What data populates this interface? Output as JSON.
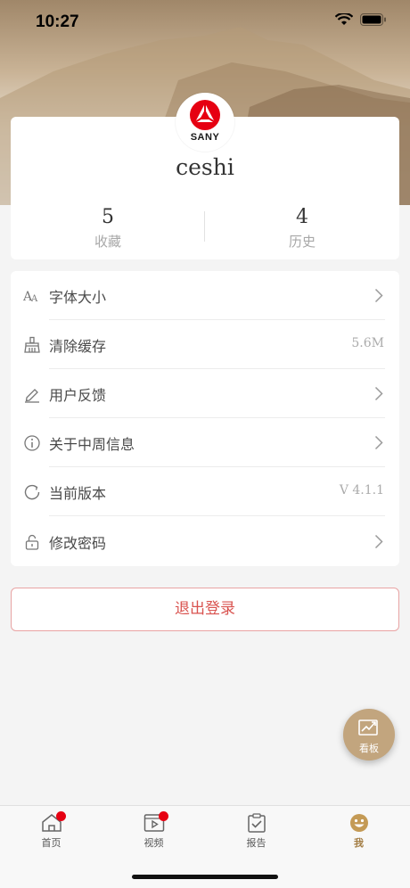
{
  "status_bar": {
    "time": "10:27"
  },
  "profile": {
    "brand": "SANY",
    "username": "ceshi",
    "stats": [
      {
        "value": "5",
        "label": "收藏"
      },
      {
        "value": "4",
        "label": "历史"
      }
    ]
  },
  "menu": [
    {
      "label": "字体大小",
      "value": null,
      "icon": "font-size-icon"
    },
    {
      "label": "清除缓存",
      "value": "5.6M",
      "icon": "broom-icon"
    },
    {
      "label": "用户反馈",
      "value": null,
      "icon": "pen-icon"
    },
    {
      "label": "关于中周信息",
      "value": null,
      "icon": "info-icon"
    },
    {
      "label": "当前版本",
      "value": "V 4.1.1",
      "icon": "refresh-icon"
    },
    {
      "label": "修改密码",
      "value": null,
      "icon": "lock-icon"
    }
  ],
  "logout": {
    "label": "退出登录"
  },
  "fab": {
    "label": "看板"
  },
  "tabbar": {
    "tabs": [
      {
        "label": "首页",
        "badge": true
      },
      {
        "label": "视频",
        "badge": true
      },
      {
        "label": "报告",
        "badge": false
      },
      {
        "label": "我",
        "badge": false,
        "active": true
      }
    ]
  },
  "colors": {
    "accent": "#a37d44",
    "danger": "#d9534f",
    "badge": "#e60012",
    "fab": "#c2a57e"
  }
}
